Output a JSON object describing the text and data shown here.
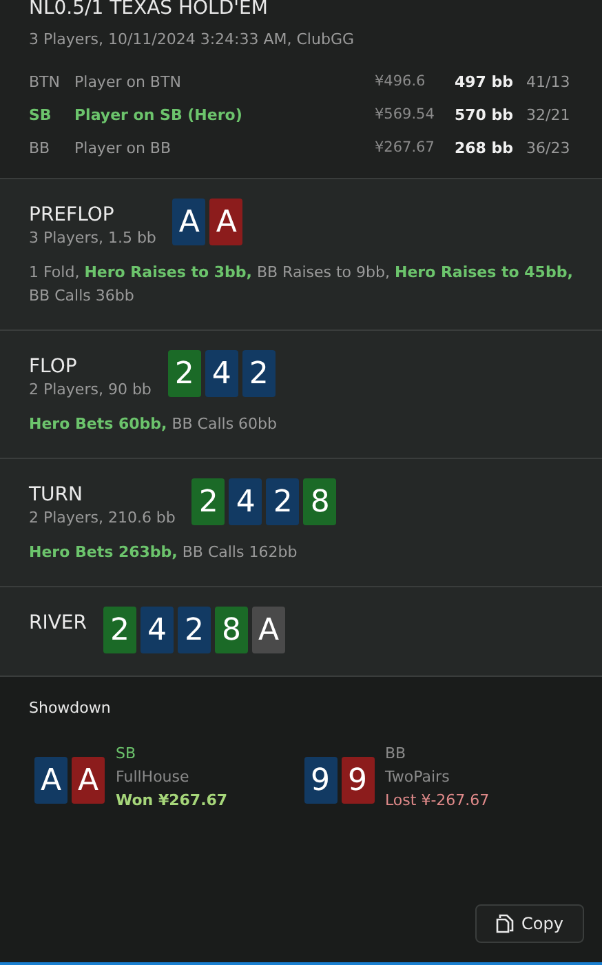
{
  "title": "NL0.5/1 TEXAS HOLD'EM",
  "subtitle": "3 Players, 10/11/2024 3:24:33 AM, ClubGG",
  "players": [
    {
      "position": "BTN",
      "name": "Player on BTN",
      "amount": "¥496.6",
      "bb": "497 bb",
      "stat": "41/13",
      "hero": false
    },
    {
      "position": "SB",
      "name": "Player on SB (Hero)",
      "amount": "¥569.54",
      "bb": "570 bb",
      "stat": "32/21",
      "hero": true
    },
    {
      "position": "BB",
      "name": "Player on BB",
      "amount": "¥267.67",
      "bb": "268 bb",
      "stat": "36/23",
      "hero": false
    }
  ],
  "streets": [
    {
      "name": "PREFLOP",
      "info": "3 Players, 1.5 bb",
      "cards": [
        {
          "rank": "A",
          "color": "#123a63"
        },
        {
          "rank": "A",
          "color": "#8c1c1c"
        }
      ],
      "actions": [
        {
          "text": "1 Fold,",
          "hero": false
        },
        {
          "text": "Hero Raises to 3bb,",
          "hero": true
        },
        {
          "text": "BB Raises to 9bb,",
          "hero": false
        },
        {
          "text": "Hero Raises to 45bb,",
          "hero": true
        },
        {
          "text": "BB Calls 36bb",
          "hero": false
        }
      ]
    },
    {
      "name": "FLOP",
      "info": "2 Players, 90 bb",
      "cards": [
        {
          "rank": "2",
          "color": "#1b6a27"
        },
        {
          "rank": "4",
          "color": "#123a63"
        },
        {
          "rank": "2",
          "color": "#123a63"
        }
      ],
      "actions": [
        {
          "text": "Hero Bets 60bb,",
          "hero": true
        },
        {
          "text": "BB Calls 60bb",
          "hero": false
        }
      ]
    },
    {
      "name": "TURN",
      "info": "2 Players, 210.6 bb",
      "cards": [
        {
          "rank": "2",
          "color": "#1b6a27"
        },
        {
          "rank": "4",
          "color": "#123a63"
        },
        {
          "rank": "2",
          "color": "#123a63"
        },
        {
          "rank": "8",
          "color": "#1b6a27"
        }
      ],
      "actions": [
        {
          "text": "Hero Bets 263bb,",
          "hero": true
        },
        {
          "text": "BB Calls 162bb",
          "hero": false
        }
      ]
    },
    {
      "name": "RIVER",
      "cards": [
        {
          "rank": "2",
          "color": "#1b6a27"
        },
        {
          "rank": "4",
          "color": "#123a63"
        },
        {
          "rank": "2",
          "color": "#123a63"
        },
        {
          "rank": "8",
          "color": "#1b6a27"
        },
        {
          "rank": "A",
          "color": "#4a4a4a"
        }
      ]
    }
  ],
  "showdown": {
    "title": "Showdown",
    "hands": [
      {
        "cards": [
          {
            "rank": "A",
            "color": "#123a63"
          },
          {
            "rank": "A",
            "color": "#8c1c1c"
          }
        ],
        "position": "SB",
        "hero": true,
        "hand": "FullHouse",
        "result": "Won ¥267.67",
        "won": true
      },
      {
        "cards": [
          {
            "rank": "9",
            "color": "#123a63"
          },
          {
            "rank": "9",
            "color": "#8c1c1c"
          }
        ],
        "position": "BB",
        "hero": false,
        "hand": "TwoPairs",
        "result": "Lost ¥-267.67",
        "won": false
      }
    ]
  },
  "copy_button": "Copy"
}
